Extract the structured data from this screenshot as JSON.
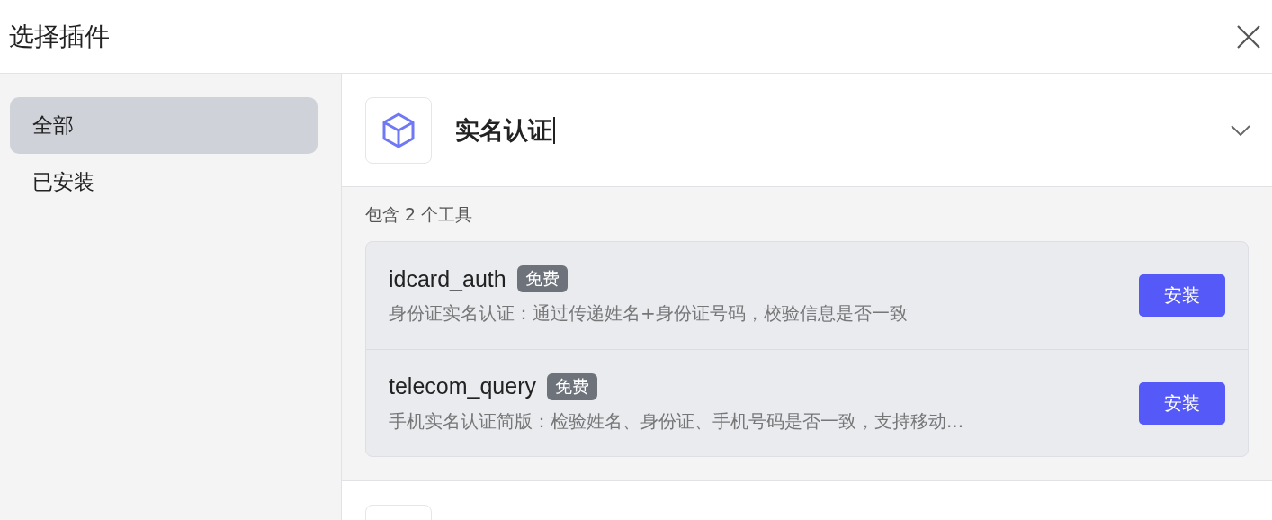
{
  "window": {
    "title": "选择插件"
  },
  "sidebar": {
    "items": [
      {
        "label": "全部",
        "selected": true
      },
      {
        "label": "已安装",
        "selected": false
      }
    ]
  },
  "plugins": [
    {
      "name": "实名认证",
      "expanded": true,
      "tool_count": "包含 2 个工具",
      "tools": [
        {
          "name": "idcard_auth",
          "badge": "免费",
          "description": "身份证实名认证：通过传递姓名+身份证号码，校验信息是否一致",
          "button": "安装"
        },
        {
          "name": "telecom_query",
          "badge": "免费",
          "description": "手机实名认证简版：检验姓名、身份证、手机号码是否一致，支持移动...",
          "button": "安装"
        }
      ]
    },
    {
      "kind": "cut"
    }
  ]
}
